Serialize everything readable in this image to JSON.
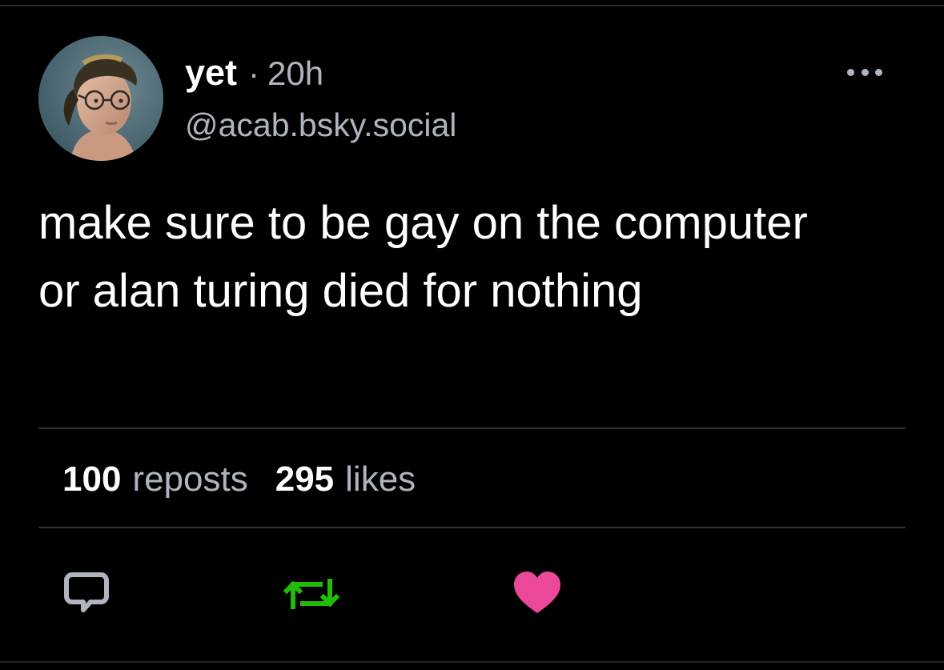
{
  "post": {
    "author": {
      "display_name": "yet",
      "handle": "@acab.bsky.social",
      "avatar_icon": "person-portrait"
    },
    "separator": "·",
    "timestamp": "20h",
    "more_icon": "ellipsis-icon",
    "text": "make sure to be gay on the computer or alan turing died for nothing",
    "stats": {
      "reposts_count": "100",
      "reposts_label": "reposts",
      "likes_count": "295",
      "likes_label": "likes"
    },
    "actions": {
      "reply_icon": "speech-bubble-icon",
      "repost_icon": "repost-arrows-icon",
      "like_icon": "heart-icon"
    }
  },
  "colors": {
    "background": "#000000",
    "primary_text": "#ffffff",
    "secondary_text": "#aeb5bf",
    "divider": "#2e3238",
    "reply": "#aeb5bf",
    "repost": "#20bc07",
    "like": "#ec4899"
  }
}
